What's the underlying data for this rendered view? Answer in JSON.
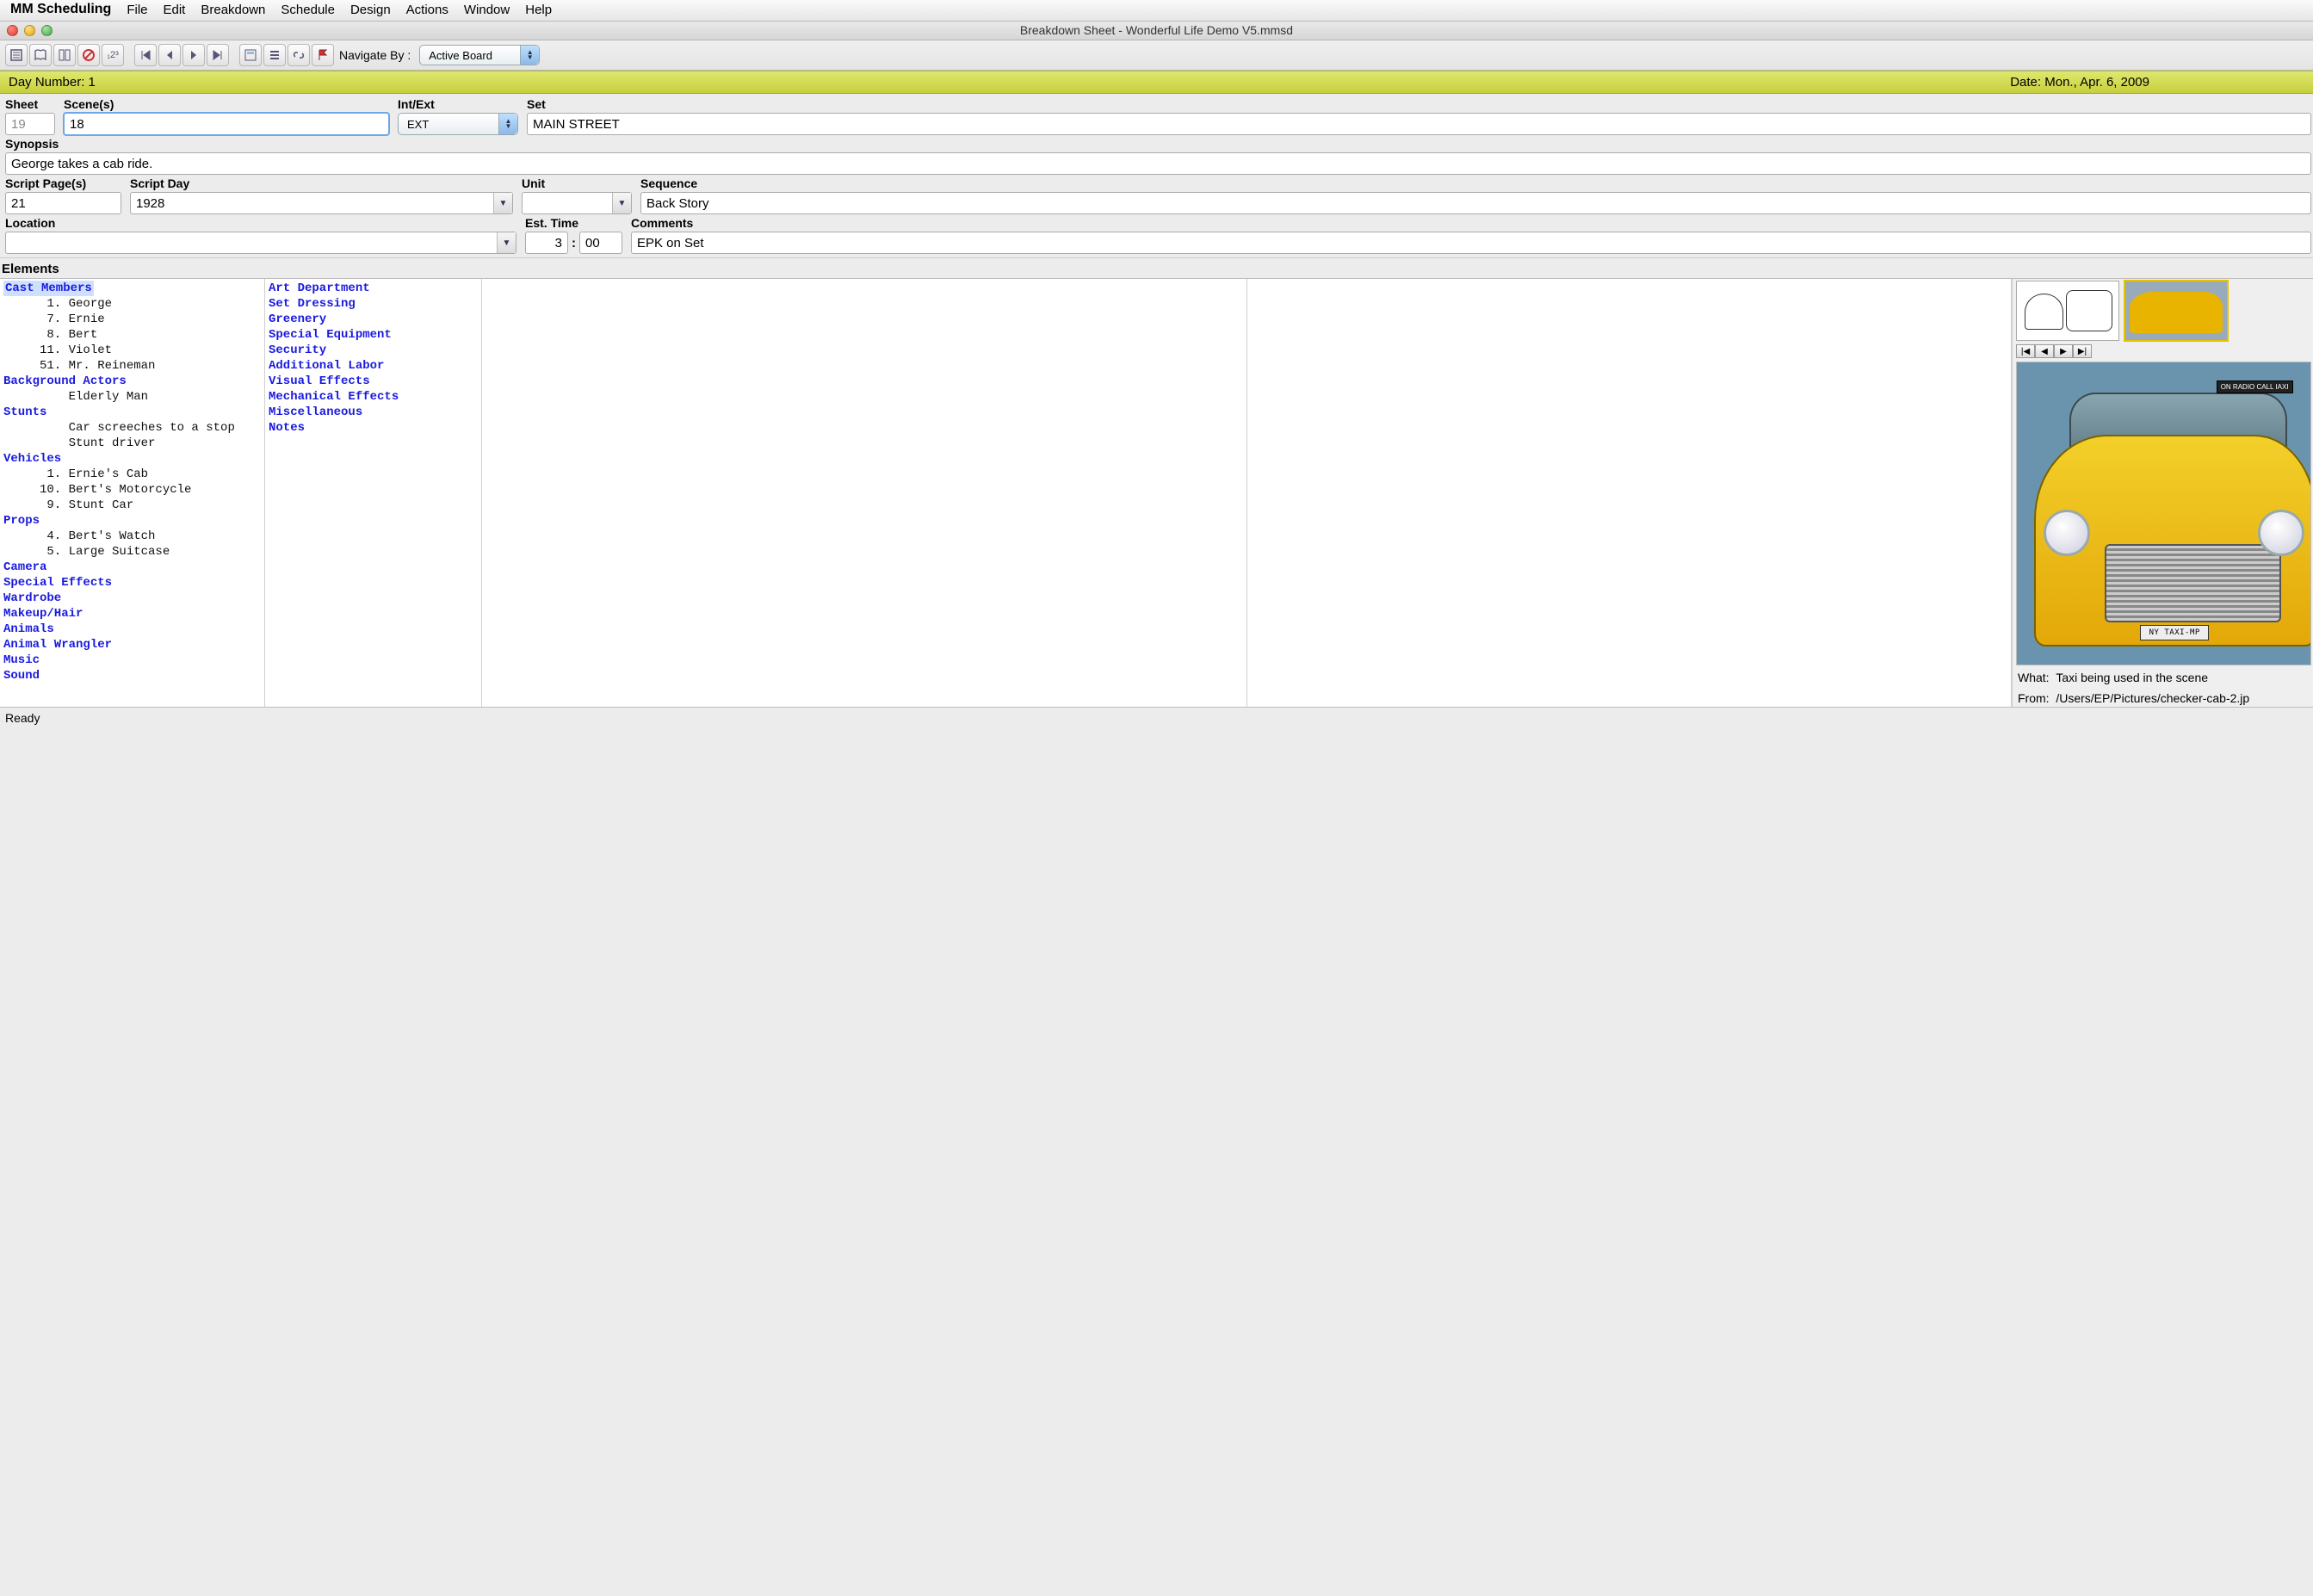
{
  "menubar": {
    "app_name": "MM Scheduling",
    "items": [
      "File",
      "Edit",
      "Breakdown",
      "Schedule",
      "Design",
      "Actions",
      "Window",
      "Help"
    ]
  },
  "titlebar": {
    "title": "Breakdown Sheet - Wonderful Life Demo V5.mmsd"
  },
  "toolbar": {
    "navigate_by_label": "Navigate By :",
    "navigate_by_value": "Active Board"
  },
  "day_banner": {
    "day_label": "Day Number: 1",
    "date_label": "Date: Mon., Apr. 6, 2009"
  },
  "form": {
    "sheet_label": "Sheet",
    "sheet_value": "19",
    "scenes_label": "Scene(s)",
    "scenes_value": "18",
    "intext_label": "Int/Ext",
    "intext_value": "EXT",
    "set_label": "Set",
    "set_value": "MAIN STREET",
    "synopsis_label": "Synopsis",
    "synopsis_value": "George takes a cab ride.",
    "script_pages_label": "Script Page(s)",
    "script_pages_value": "21",
    "script_day_label": "Script Day",
    "script_day_value": "1928",
    "unit_label": "Unit",
    "unit_value": "",
    "sequence_label": "Sequence",
    "sequence_value": "Back Story",
    "location_label": "Location",
    "location_value": "",
    "est_time_label": "Est. Time",
    "est_time_h": "3",
    "est_time_m": "00",
    "comments_label": "Comments",
    "comments_value": "EPK on Set"
  },
  "elements_header": "Elements",
  "elements_col1": [
    {
      "cat": "Cast Members",
      "selected": true
    },
    {
      "item": "      1. George"
    },
    {
      "item": "      7. Ernie"
    },
    {
      "item": "      8. Bert"
    },
    {
      "item": "     11. Violet"
    },
    {
      "item": "     51. Mr. Reineman"
    },
    {
      "cat": "Background Actors"
    },
    {
      "item": "         Elderly Man"
    },
    {
      "cat": "Stunts"
    },
    {
      "item": "         Car screeches to a stop"
    },
    {
      "item": "         Stunt driver"
    },
    {
      "cat": "Vehicles"
    },
    {
      "item": "      1. Ernie's Cab"
    },
    {
      "item": "     10. Bert's Motorcycle"
    },
    {
      "item": "      9. Stunt Car"
    },
    {
      "cat": "Props"
    },
    {
      "item": "      4. Bert's Watch"
    },
    {
      "item": "      5. Large Suitcase"
    },
    {
      "cat": "Camera"
    },
    {
      "cat": "Special Effects"
    },
    {
      "cat": "Wardrobe"
    },
    {
      "cat": "Makeup/Hair"
    },
    {
      "cat": "Animals"
    },
    {
      "cat": "Animal Wrangler"
    },
    {
      "cat": "Music"
    },
    {
      "cat": "Sound"
    }
  ],
  "elements_col2": [
    {
      "cat": "Art Department"
    },
    {
      "cat": "Set Dressing"
    },
    {
      "cat": "Greenery"
    },
    {
      "cat": "Special Equipment"
    },
    {
      "cat": "Security"
    },
    {
      "cat": "Additional Labor"
    },
    {
      "cat": "Visual Effects"
    },
    {
      "cat": "Mechanical Effects"
    },
    {
      "cat": "Miscellaneous"
    },
    {
      "cat": "Notes"
    }
  ],
  "media": {
    "plate_text": "NY TAXI-MP",
    "sign_text": "ON RADIO CALL  IAXI",
    "what_label": "What:",
    "what_value": "Taxi being used in the scene",
    "from_label": "From:",
    "from_value": "/Users/EP/Pictures/checker-cab-2.jp"
  },
  "statusbar": {
    "text": "Ready"
  }
}
